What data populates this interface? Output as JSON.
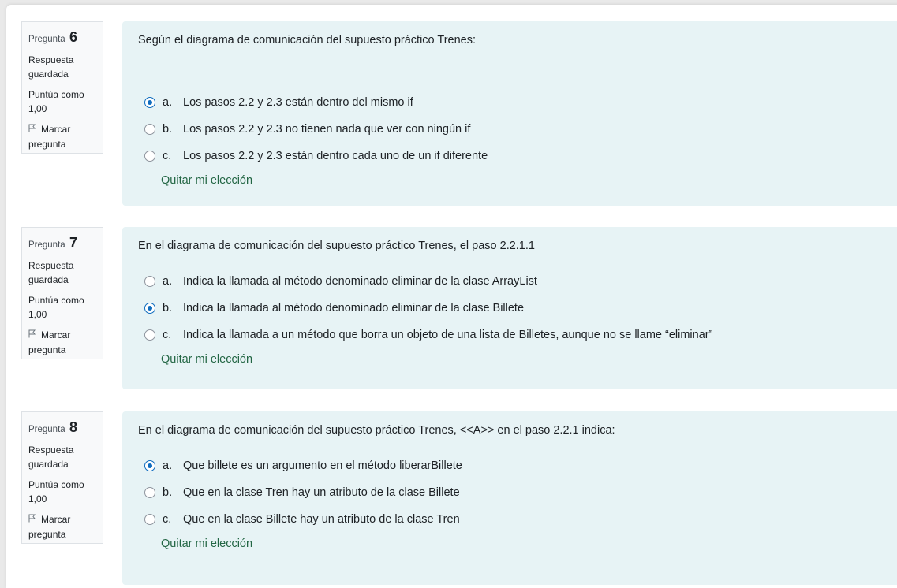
{
  "questions": [
    {
      "label": "Pregunta",
      "number": "6",
      "state": "Respuesta guardada",
      "grade_line1": "Puntúa como",
      "grade_line2": "1,00",
      "flag_line1": "Marcar",
      "flag_line2": "pregunta",
      "text": "Según el diagrama de comunicación del supuesto práctico Trenes:",
      "options": [
        {
          "letter": "a.",
          "text": "Los pasos 2.2 y 2.3 están dentro del mismo if",
          "checked": true
        },
        {
          "letter": "b.",
          "text": "Los pasos 2.2 y 2.3 no tienen nada que ver con ningún if",
          "checked": false
        },
        {
          "letter": "c.",
          "text": "Los pasos 2.2 y 2.3 están dentro cada uno de un if diferente",
          "checked": false
        }
      ],
      "clear": "Quitar mi elección"
    },
    {
      "label": "Pregunta",
      "number": "7",
      "state": "Respuesta guardada",
      "grade_line1": "Puntúa como",
      "grade_line2": "1,00",
      "flag_line1": "Marcar",
      "flag_line2": "pregunta",
      "text": "En el diagrama de comunicación del supuesto práctico Trenes, el paso 2.2.1.1",
      "options": [
        {
          "letter": "a.",
          "text": "Indica la llamada al método denominado eliminar de la clase ArrayList",
          "checked": false
        },
        {
          "letter": "b.",
          "text": "Indica la llamada al método denominado eliminar de la clase Billete",
          "checked": true
        },
        {
          "letter": "c.",
          "text": "Indica la llamada a un método que borra un objeto de una lista de Billetes, aunque no se llame “eliminar”",
          "checked": false
        }
      ],
      "clear": "Quitar mi elección"
    },
    {
      "label": "Pregunta",
      "number": "8",
      "state": "Respuesta guardada",
      "grade_line1": "Puntúa como",
      "grade_line2": "1,00",
      "flag_line1": "Marcar",
      "flag_line2": "pregunta",
      "text": "En el diagrama de comunicación del supuesto práctico Trenes, <<A>> en el paso 2.2.1 indica:",
      "options": [
        {
          "letter": "a.",
          "text": "Que billete es un argumento en el método liberarBillete",
          "checked": true
        },
        {
          "letter": "b.",
          "text": "Que en la clase Tren hay un atributo de la clase Billete",
          "checked": false
        },
        {
          "letter": "c.",
          "text": "Que en la clase Billete hay un atributo de la clase Tren",
          "checked": false
        }
      ],
      "clear": "Quitar mi elección"
    }
  ],
  "colors": {
    "accent": "#0f6cbf",
    "content_bg": "#e7f3f5",
    "link": "#236644"
  }
}
